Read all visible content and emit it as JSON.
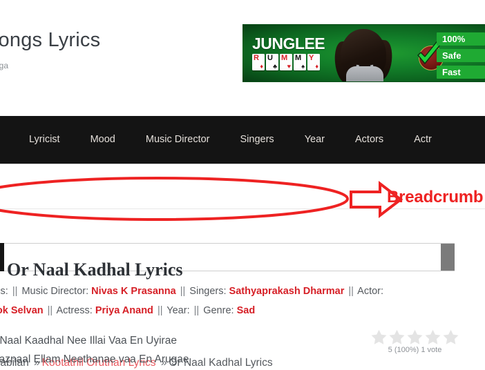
{
  "site": {
    "title": "Songs Lyrics",
    "tagline": "zhga"
  },
  "banner_ad": {
    "brand_primary": "JUNGLEE",
    "brand_cards": [
      {
        "letter": "R",
        "suit": "♦",
        "suit_color": "red"
      },
      {
        "letter": "U",
        "suit": "♣",
        "suit_color": "black"
      },
      {
        "letter": "M",
        "suit": "♥",
        "suit_color": "red"
      },
      {
        "letter": "M",
        "suit": "♠",
        "suit_color": "black"
      },
      {
        "letter": "Y",
        "suit": "♦",
        "suit_color": "red"
      }
    ],
    "pills": [
      "100%",
      "Safe",
      "Fast"
    ],
    "accent_green": "#1faa33"
  },
  "nav": {
    "items": [
      {
        "label": "Lyricist"
      },
      {
        "label": "Mood"
      },
      {
        "label": "Music Director"
      },
      {
        "label": "Singers"
      },
      {
        "label": "Year"
      },
      {
        "label": "Actors"
      },
      {
        "label": "Actr"
      }
    ]
  },
  "breadcrumb": {
    "parts": [
      {
        "text": "Kabilan",
        "type": "plain"
      },
      {
        "text": "»",
        "type": "sep"
      },
      {
        "text": "Kootathil Oruthan Lyrics",
        "type": "link"
      },
      {
        "text": "»",
        "type": "sep"
      },
      {
        "text": "Or Naal Kadhal Lyrics",
        "type": "plain"
      }
    ]
  },
  "annotation": {
    "label": "Breadcrumb",
    "color": "#ee2222"
  },
  "page": {
    "title": "Or Naal Kadhal Lyrics"
  },
  "meta": {
    "line1": [
      {
        "text": "yrics:",
        "type": "label"
      },
      {
        "text": "||",
        "type": "sep"
      },
      {
        "text": "Music Director:",
        "type": "label"
      },
      {
        "text": "Nivas K Prasanna",
        "type": "value"
      },
      {
        "text": "||",
        "type": "sep"
      },
      {
        "text": "Singers:",
        "type": "label"
      },
      {
        "text": "Sathyaprakash Dharmar",
        "type": "value"
      },
      {
        "text": "||",
        "type": "sep"
      },
      {
        "text": "Actor:",
        "type": "label"
      }
    ],
    "line2": [
      {
        "text": "shok Selvan",
        "type": "value"
      },
      {
        "text": "||",
        "type": "sep"
      },
      {
        "text": "Actress:",
        "type": "label"
      },
      {
        "text": "Priya Anand",
        "type": "value"
      },
      {
        "text": "||",
        "type": "sep"
      },
      {
        "text": "Year:",
        "type": "label"
      },
      {
        "text": "||",
        "type": "sep"
      },
      {
        "text": "Genre:",
        "type": "label"
      },
      {
        "text": "Sad",
        "type": "value"
      }
    ]
  },
  "lyrics": {
    "lines": [
      "r Naal Kaadhal Nee Illai Vaa En Uyirae",
      "aaznaal Ellam Neethanae vaa En Arugae"
    ]
  },
  "rating": {
    "stars_total": 5,
    "stars_filled": 0,
    "summary": "5 (100%) 1 vote",
    "star_color": "#e4e4e4"
  }
}
